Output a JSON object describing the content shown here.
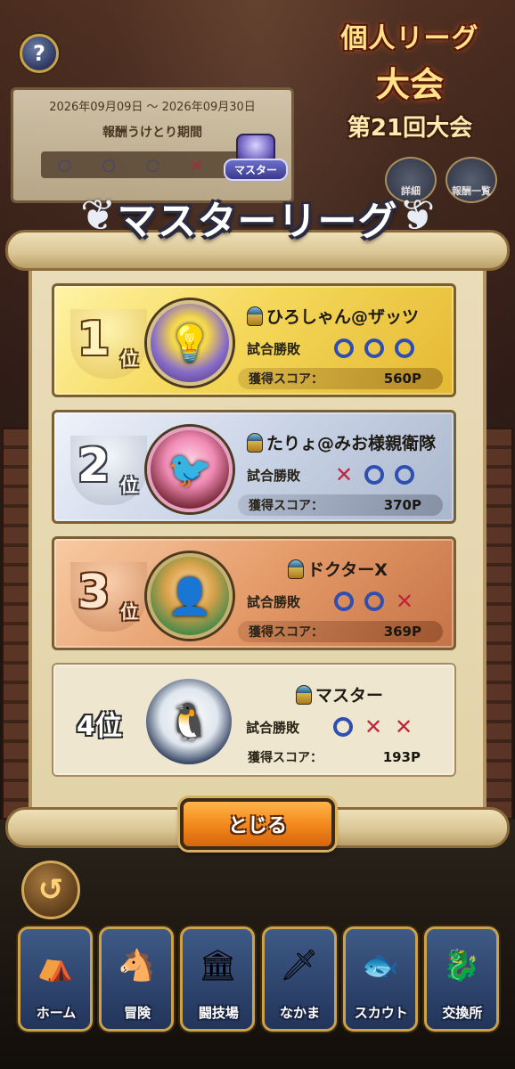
{
  "header": {
    "help_label": "?",
    "event_title_line1": "個人リーグ",
    "event_title_line2": "大会",
    "event_round": "第21回大会",
    "period_dates": "2026年09月09日 ～ 2026年09月30日",
    "period_title": "報酬うけとり期間",
    "side_buttons": [
      {
        "label": "詳細",
        "icon": "scroll-icon"
      },
      {
        "label": "報酬一覧",
        "icon": "treasure-icon"
      }
    ]
  },
  "league": {
    "badge_label": "マスター",
    "title": "マスターリーグ"
  },
  "rankings": [
    {
      "rank": "1",
      "rank_suffix": "位",
      "name": "ひろしゃん@ザッツ",
      "result_label": "試合勝敗",
      "results": [
        "win",
        "win",
        "win"
      ],
      "score_label": "獲得スコア：",
      "score": "560P",
      "tier": "gold"
    },
    {
      "rank": "2",
      "rank_suffix": "位",
      "name": "たりょ@みお様親衛隊",
      "result_label": "試合勝敗",
      "results": [
        "lose",
        "win",
        "win"
      ],
      "score_label": "獲得スコア：",
      "score": "370P",
      "tier": "silver"
    },
    {
      "rank": "3",
      "rank_suffix": "位",
      "name": "ドクターX",
      "result_label": "試合勝敗",
      "results": [
        "win",
        "win",
        "lose"
      ],
      "score_label": "獲得スコア：",
      "score": "369P",
      "tier": "bronze"
    },
    {
      "rank_text": "4位",
      "name": "マスター",
      "result_label": "試合勝敗",
      "results": [
        "win",
        "lose",
        "lose"
      ],
      "score_label": "獲得スコア：",
      "score": "193P",
      "tier": "plain"
    }
  ],
  "close_button": "とじる",
  "back_button_icon": "undo-arrow-icon",
  "nav": [
    {
      "label": "ホーム",
      "icon": "tent-icon"
    },
    {
      "label": "冒険",
      "icon": "wagon-icon"
    },
    {
      "label": "闘技場",
      "icon": "colosseum-icon"
    },
    {
      "label": "なかま",
      "icon": "monsters-icon"
    },
    {
      "label": "スカウト",
      "icon": "scout-icon"
    },
    {
      "label": "交換所",
      "icon": "exchange-icon"
    }
  ],
  "colors": {
    "win": "#2f4fb0",
    "lose": "#c0253a",
    "close_button": "#f38a1e",
    "gold_card": "#f5d85a",
    "silver_card": "#c9d3e6",
    "bronze_card": "#e59b6a"
  }
}
